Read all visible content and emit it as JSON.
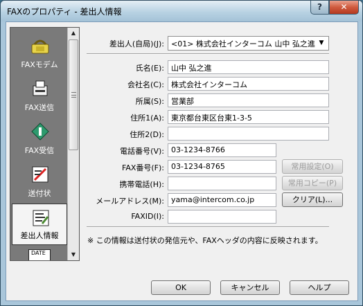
{
  "window": {
    "title": "FAXのプロパティ - 差出人情報",
    "help": "?",
    "close": "✕"
  },
  "nav": {
    "items": [
      {
        "label": "FAXモデム",
        "icon": "fax-modem-icon"
      },
      {
        "label": "FAX送信",
        "icon": "fax-send-icon"
      },
      {
        "label": "FAX受信",
        "icon": "fax-receive-icon"
      },
      {
        "label": "送付状",
        "icon": "cover-sheet-icon"
      },
      {
        "label": "差出人情報",
        "icon": "sender-info-icon",
        "selected": true
      },
      {
        "label": "DATE",
        "icon": "date-icon"
      }
    ]
  },
  "form": {
    "sender_label": "差出人(自局)(J):",
    "sender_value": "<01> 株式会社インターコム 山中 弘之進",
    "name_label": "氏名(E):",
    "name_value": "山中 弘之進",
    "company_label": "会社名(C):",
    "company_value": "株式会社インターコム",
    "dept_label": "所属(S):",
    "dept_value": "営業部",
    "addr1_label": "住所1(A):",
    "addr1_value": "東京都台東区台東1-3-5",
    "addr2_label": "住所2(D):",
    "addr2_value": "",
    "phone_label": "電話番号(V):",
    "phone_value": "03-1234-8766",
    "fax_label": "FAX番号(F):",
    "fax_value": "03-1234-8765",
    "mobile_label": "携帯電話(H):",
    "mobile_value": "",
    "email_label": "メールアドレス(M):",
    "email_value": "yama@intercom.co.jp",
    "faxid_label": "FAXID(I):",
    "faxid_value": "",
    "common_settings_btn": "常用設定(O)",
    "common_copy_btn": "常用コピー(P)",
    "clear_btn": "クリア(L)...",
    "note": "※ この情報は送付状の発信元や、FAXヘッダの内容に反映されます。"
  },
  "buttons": {
    "ok": "OK",
    "cancel": "キャンセル",
    "help": "ヘルプ"
  }
}
